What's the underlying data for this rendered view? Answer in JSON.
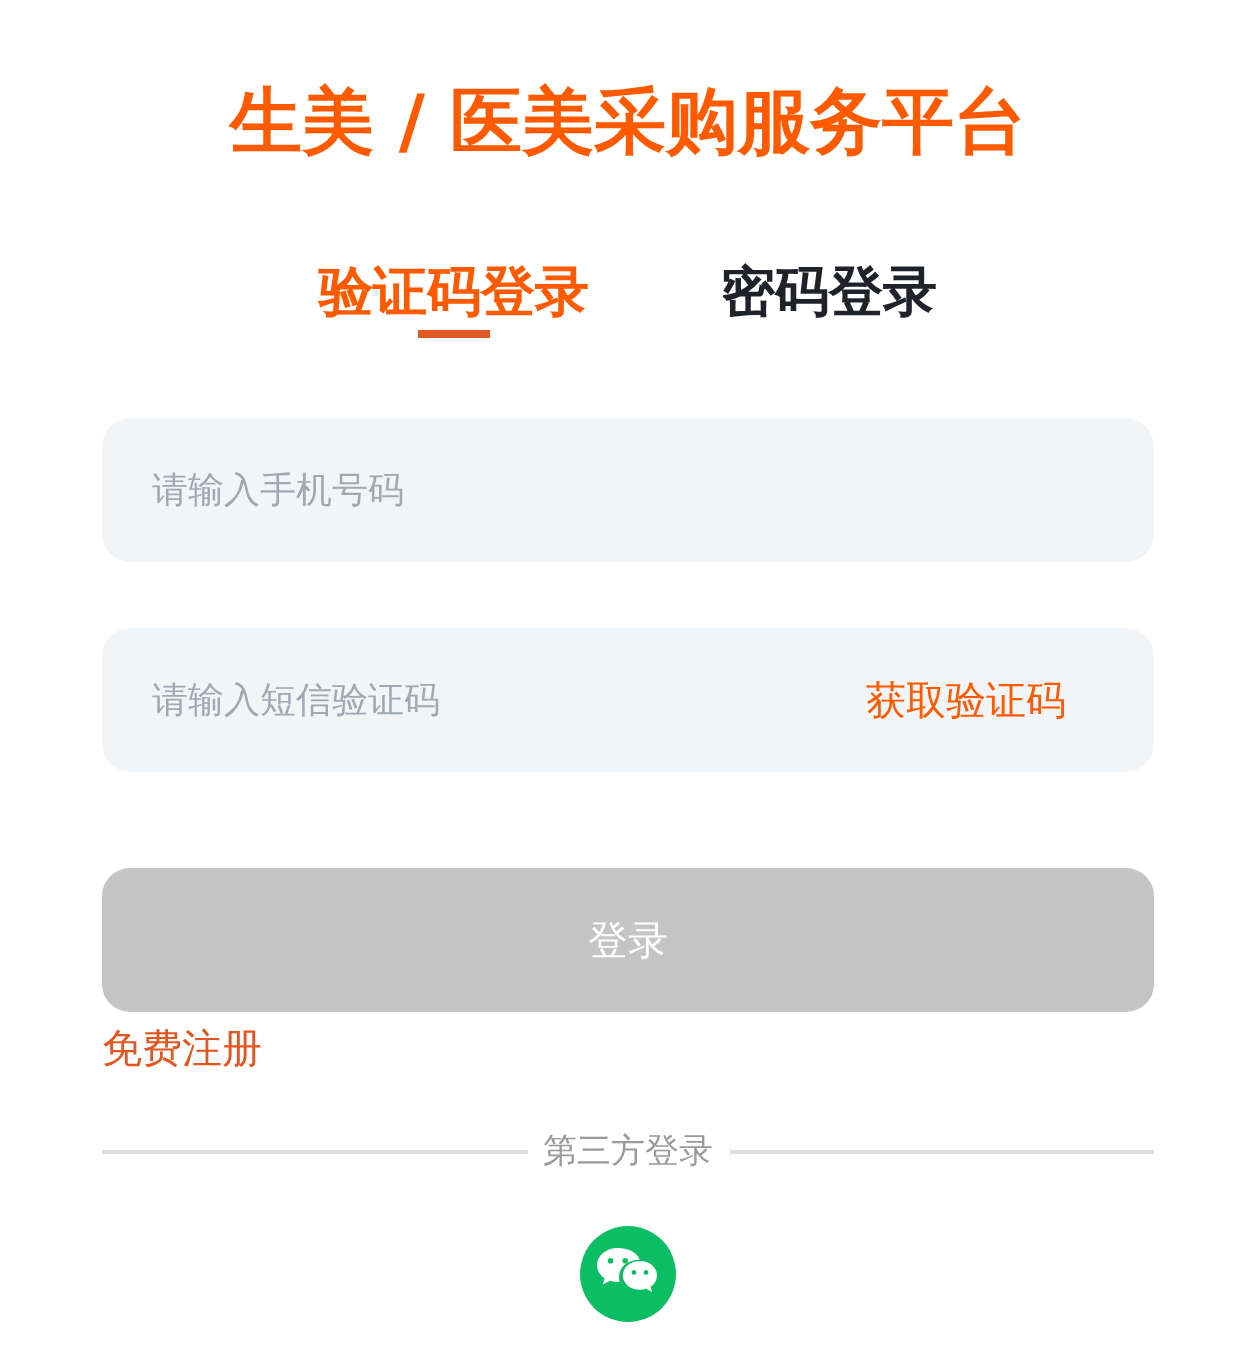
{
  "title": "生美 / 医美采购服务平台",
  "tabs": [
    {
      "label": "验证码登录",
      "selected": true
    },
    {
      "label": "密码登录",
      "selected": false
    }
  ],
  "phone_field": {
    "placeholder": "请输入手机号码"
  },
  "code_field": {
    "placeholder": "请输入短信验证码",
    "action": "获取验证码"
  },
  "login_button": {
    "label": "登录",
    "disabled": true
  },
  "register_link": "免费注册",
  "third_party": {
    "label": "第三方登录",
    "providers": [
      {
        "kind": "wechat"
      }
    ]
  }
}
